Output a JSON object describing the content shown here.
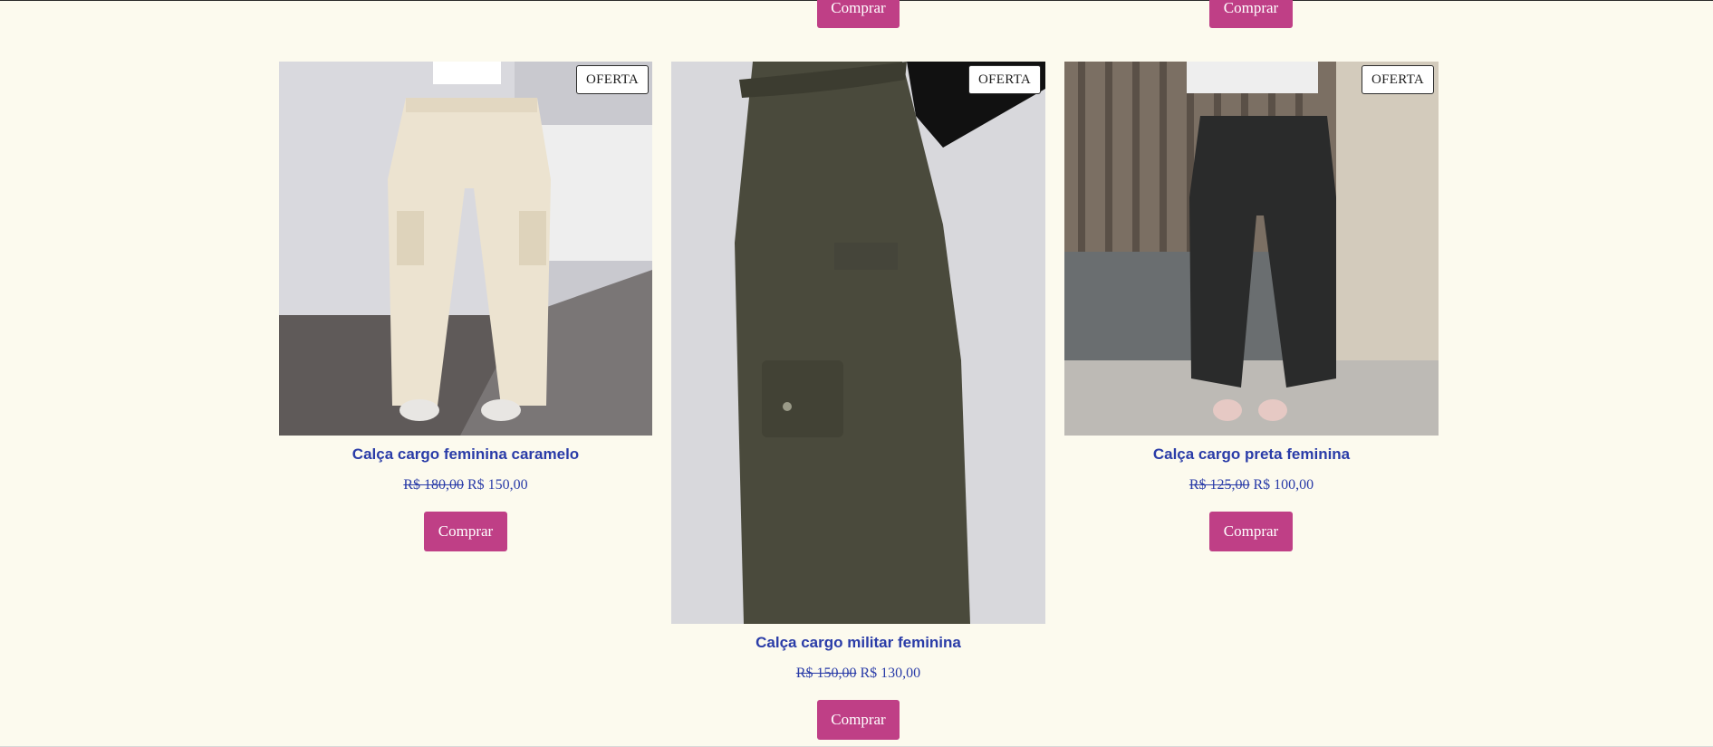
{
  "top_row": {
    "buttons": [
      "Comprar",
      "Comprar"
    ]
  },
  "products": [
    {
      "name": "Calça cargo feminina caramelo",
      "badge": "OFERTA",
      "old_price": "R$ 180,00",
      "price": "R$ 150,00",
      "button": "Comprar"
    },
    {
      "name": "Calça cargo militar feminina",
      "badge": "OFERTA",
      "old_price": "R$ 150,00",
      "price": "R$ 130,00",
      "button": "Comprar"
    },
    {
      "name": "Calça cargo preta feminina",
      "badge": "OFERTA",
      "old_price": "R$ 125,00",
      "price": "R$ 100,00",
      "button": "Comprar"
    }
  ],
  "colors": {
    "background": "#fcfaee",
    "button": "#bf3f86",
    "title": "#2a3ca8"
  }
}
